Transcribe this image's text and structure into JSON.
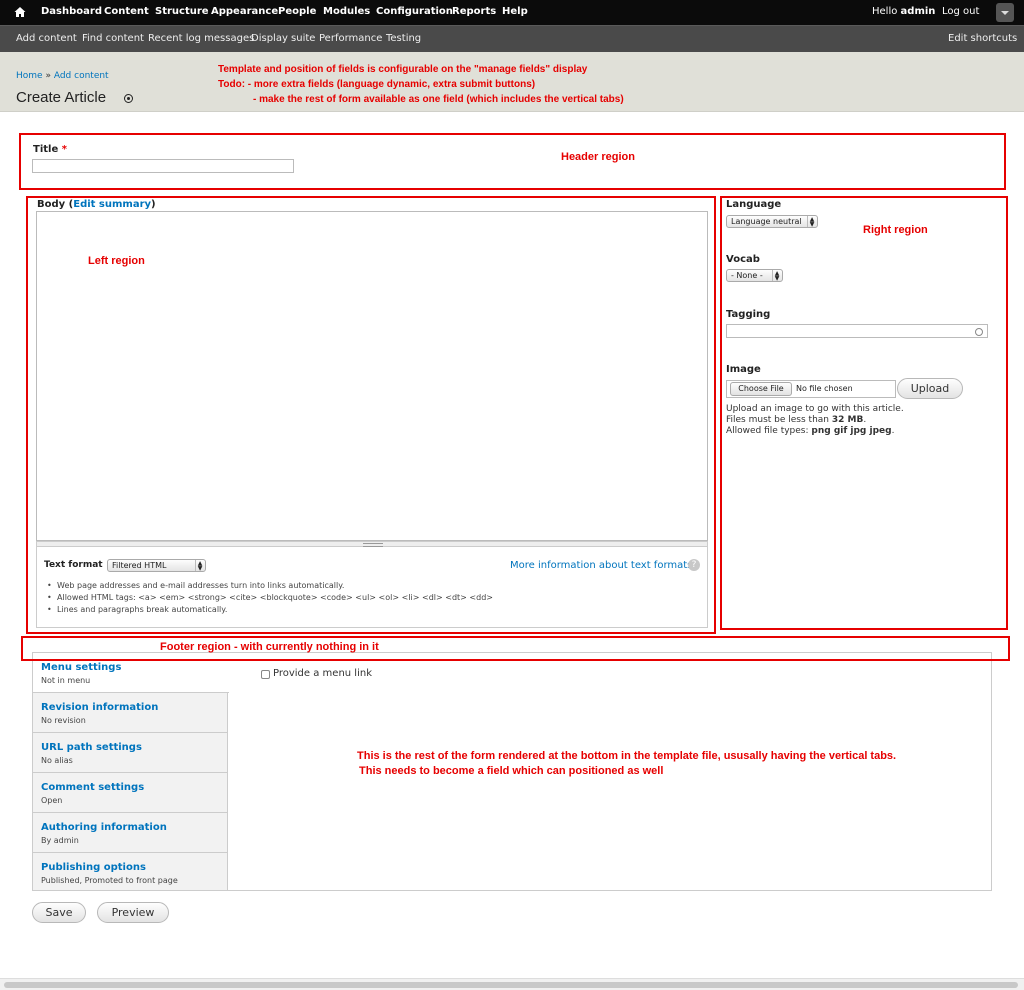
{
  "toolbar": {
    "items": [
      "Dashboard",
      "Content",
      "Structure",
      "Appearance",
      "People",
      "Modules",
      "Configuration",
      "Reports",
      "Help"
    ],
    "hello_prefix": "Hello",
    "user": "admin",
    "logout": "Log out"
  },
  "shortcuts": {
    "items": [
      "Add content",
      "Find content",
      "Recent log messages",
      "Display suite",
      "Performance",
      "Testing"
    ],
    "edit": "Edit shortcuts"
  },
  "header": {
    "breadcrumb": [
      "Home",
      "Add content"
    ],
    "breadcrumb_sep": "»",
    "title": "Create Article"
  },
  "notes": {
    "template": "Template and position of fields is configurable on the \"manage fields\" display",
    "todo1": "Todo:  - more extra fields (language dynamic, extra submit buttons)",
    "todo2": "- make the rest of form available as one field (which includes the vertical tabs)",
    "header_region": "Header region",
    "left_region": "Left region",
    "right_region": "Right region",
    "footer_region": "Footer region - with currently nothing in it",
    "rest1": "This is the rest of the form rendered at the bottom in the template file, ususally having the vertical tabs.",
    "rest2": "This needs to become a field which can positioned as well"
  },
  "form": {
    "title_label": "Title",
    "required_mark": "*",
    "body_label": "Body",
    "edit_summary": "Edit summary",
    "text_format_label": "Text format",
    "text_format_value": "Filtered HTML",
    "more_info": "More information about text formats",
    "tips": [
      "Web page addresses and e-mail addresses turn into links automatically.",
      "Allowed HTML tags: <a> <em> <strong> <cite> <blockquote> <code> <ul> <ol> <li> <dl> <dt> <dd>",
      "Lines and paragraphs break automatically."
    ],
    "language_label": "Language",
    "language_value": "Language neutral",
    "vocab_label": "Vocab",
    "vocab_value": "- None -",
    "tagging_label": "Tagging",
    "image_label": "Image",
    "choose_file": "Choose File",
    "no_file": "No file chosen",
    "upload": "Upload",
    "image_help1": "Upload an image to go with this article.",
    "image_help2_prefix": "Files must be less than",
    "image_help2_size": "32 MB",
    "image_help3_prefix": "Allowed file types:",
    "image_help3_types": "png gif jpg jpeg"
  },
  "vtabs": [
    {
      "title": "Menu settings",
      "summary": "Not in menu"
    },
    {
      "title": "Revision information",
      "summary": "No revision"
    },
    {
      "title": "URL path settings",
      "summary": "No alias"
    },
    {
      "title": "Comment settings",
      "summary": "Open"
    },
    {
      "title": "Authoring information",
      "summary": "By admin"
    },
    {
      "title": "Publishing options",
      "summary": "Published, Promoted to front page"
    }
  ],
  "menu_link_label": "Provide a menu link",
  "buttons": {
    "save": "Save",
    "preview": "Preview"
  }
}
